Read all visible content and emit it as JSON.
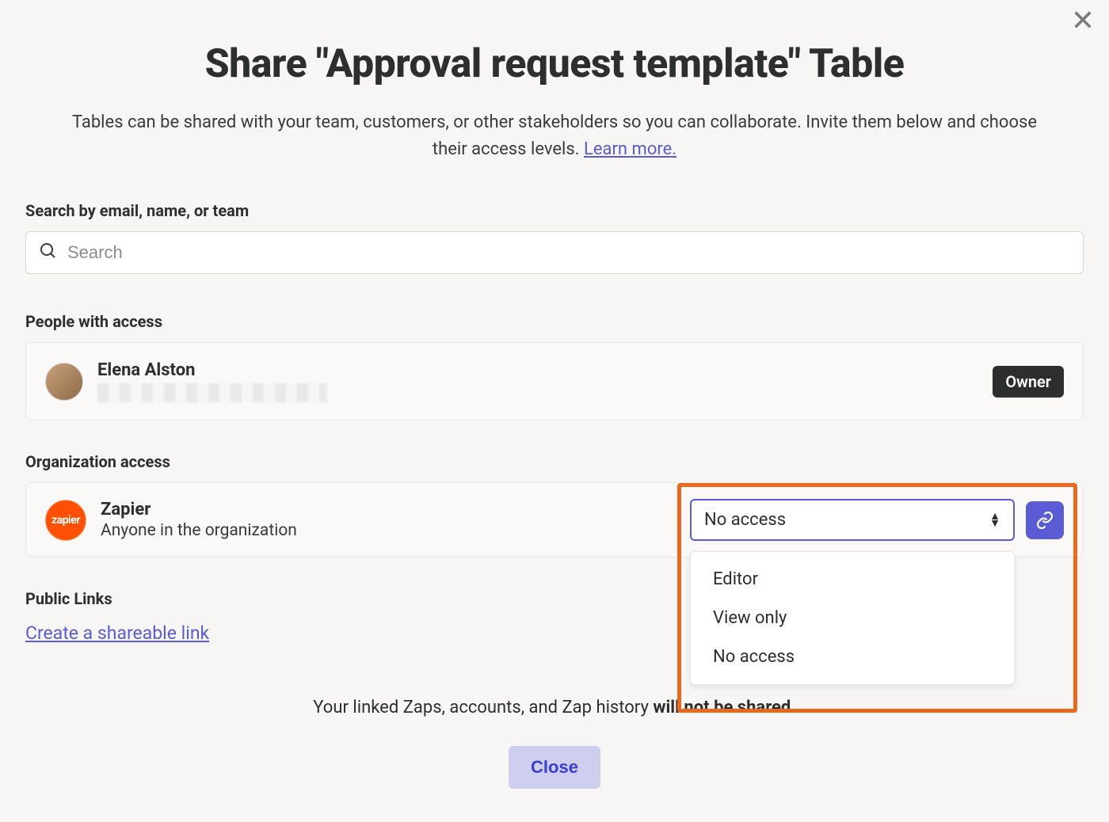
{
  "modal": {
    "title": "Share \"Approval request template\" Table",
    "description_pre": "Tables can be shared with your team, customers, or other stakeholders so you can collaborate. Invite them below and choose their access levels. ",
    "learn_more": "Learn more.",
    "close_x": "✕"
  },
  "search": {
    "label": "Search by email, name, or team",
    "placeholder": "Search"
  },
  "people": {
    "label": "People with access",
    "user_name": "Elena Alston",
    "owner_badge": "Owner"
  },
  "org": {
    "label": "Organization access",
    "name": "Zapier",
    "avatar_text": "zapier",
    "sub": "Anyone in the organization",
    "selected": "No access",
    "options": [
      "Editor",
      "View only",
      "No access"
    ]
  },
  "public_links": {
    "label": "Public Links",
    "create_link": "Create a shareable link"
  },
  "disclaimer": {
    "pre": "Your linked Zaps, accounts, and Zap history ",
    "bold": "will not be shared."
  },
  "footer": {
    "close": "Close"
  }
}
